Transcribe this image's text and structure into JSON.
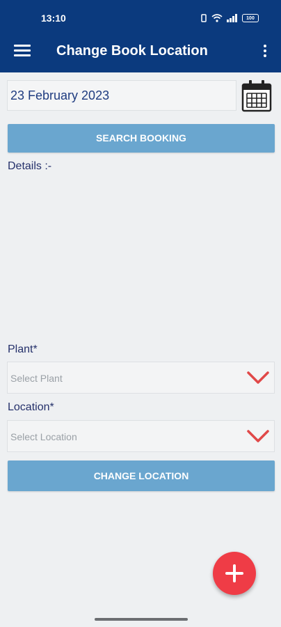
{
  "status_bar": {
    "time": "13:10",
    "battery": "100"
  },
  "header": {
    "title": "Change Book Location"
  },
  "date_field": {
    "value": "23 February 2023"
  },
  "search_button": {
    "label": "SEARCH BOOKING"
  },
  "details": {
    "label": "Details :-"
  },
  "plant": {
    "label": "Plant*",
    "placeholder": "Select Plant"
  },
  "location": {
    "label": "Location*",
    "placeholder": "Select Location"
  },
  "change_button": {
    "label": "CHANGE LOCATION"
  },
  "colors": {
    "header": "#0b3a7e",
    "button": "#6aa6cf",
    "fab": "#ef3c46",
    "chevron": "#e04848"
  },
  "icons": {
    "menu": "hamburger-menu-icon",
    "overflow": "more-vert-icon",
    "calendar": "calendar-icon",
    "dropdown": "chevron-down-icon",
    "fab": "plus-icon"
  }
}
